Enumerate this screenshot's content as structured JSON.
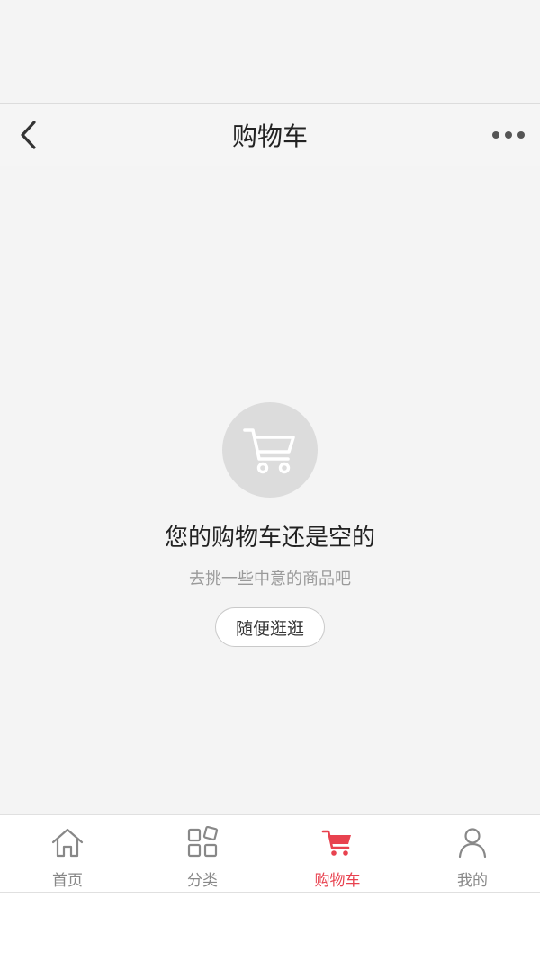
{
  "header": {
    "title": "购物车",
    "back_icon": "chevron-left-icon",
    "more_icon": "more-horizontal-icon"
  },
  "empty_state": {
    "icon": "cart-icon",
    "title": "您的购物车还是空的",
    "subtitle": "去挑一些中意的商品吧",
    "button_label": "随便逛逛"
  },
  "tab_bar": {
    "active_color": "#e8424f",
    "items": [
      {
        "label": "首页",
        "icon": "home-icon",
        "active": false
      },
      {
        "label": "分类",
        "icon": "category-icon",
        "active": false
      },
      {
        "label": "购物车",
        "icon": "cart-icon",
        "active": true
      },
      {
        "label": "我的",
        "icon": "user-icon",
        "active": false
      }
    ]
  }
}
